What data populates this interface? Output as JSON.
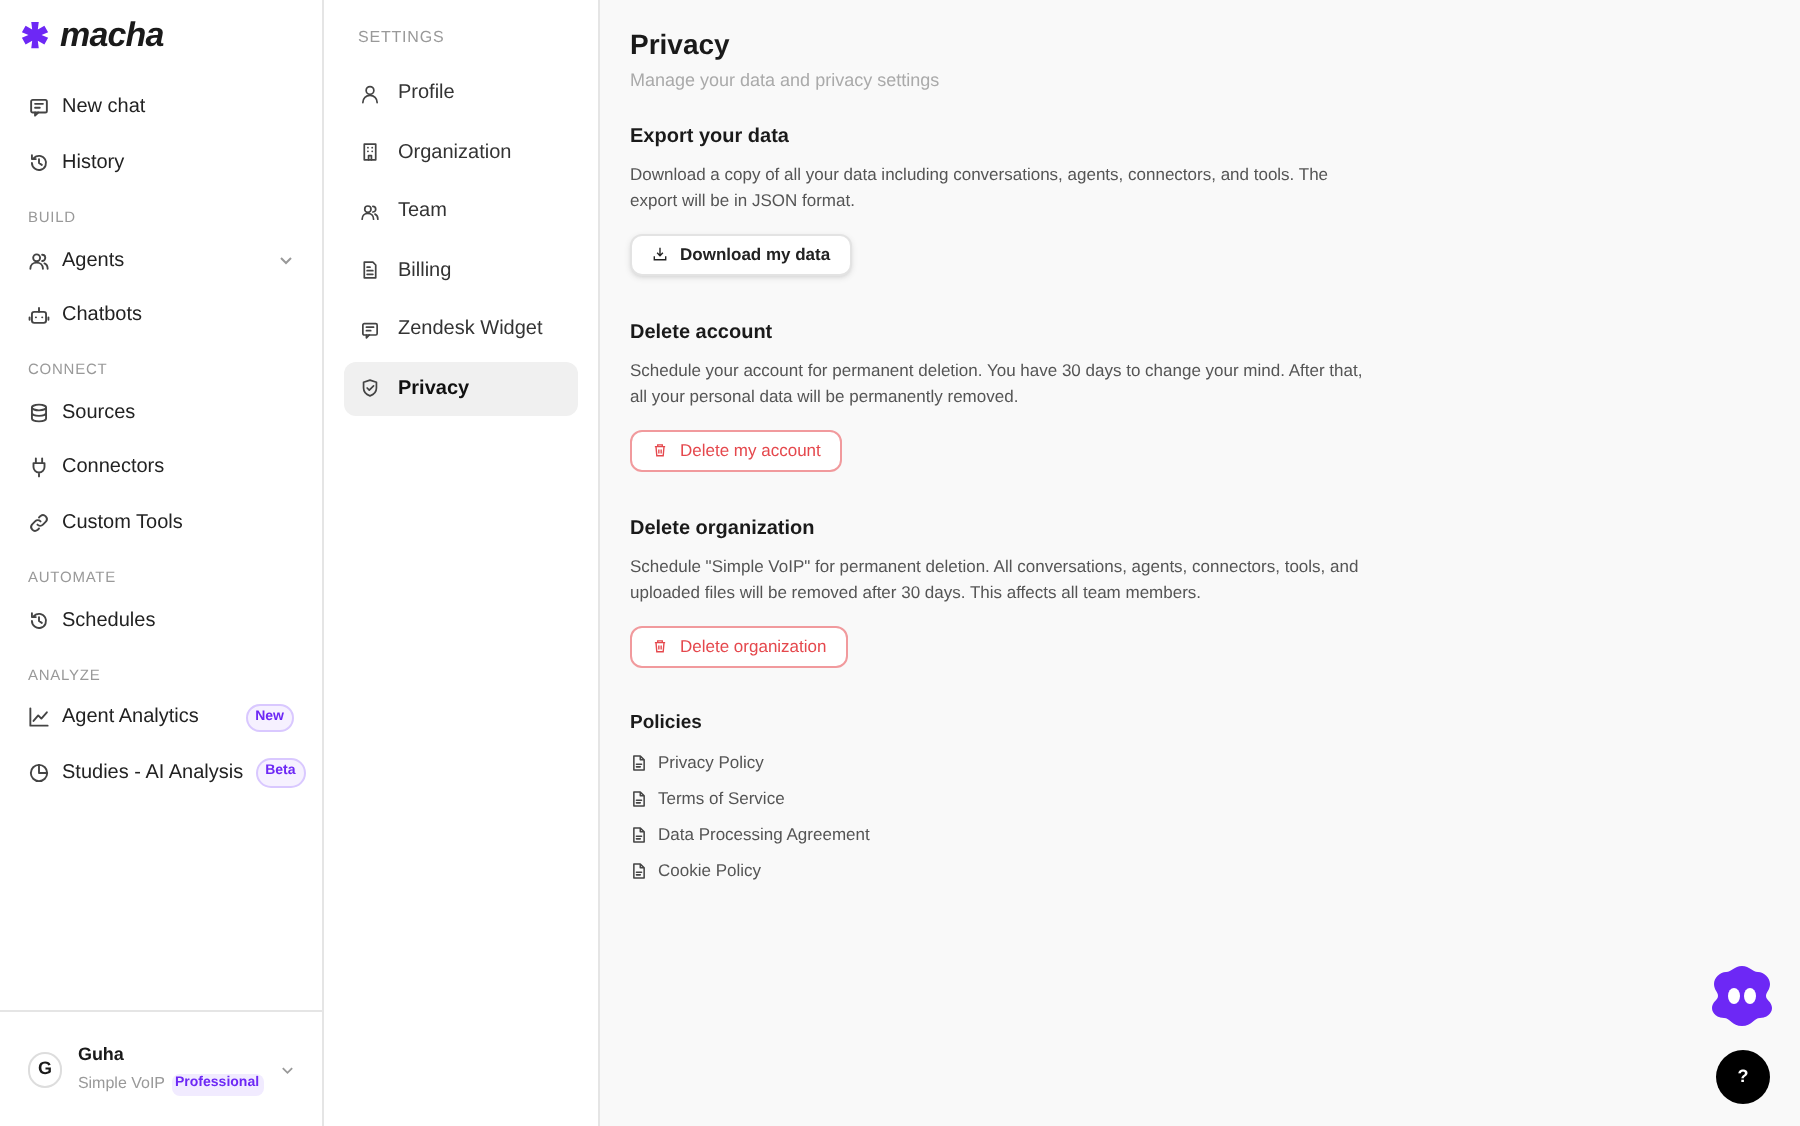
{
  "sidebar": {
    "logo": "macha",
    "top_items": [
      {
        "label": "New chat"
      },
      {
        "label": "History"
      }
    ],
    "sections": [
      {
        "heading": "BUILD",
        "items": [
          {
            "label": "Agents",
            "expanded": false
          },
          {
            "label": "Chatbots"
          }
        ]
      },
      {
        "heading": "CONNECT",
        "items": [
          {
            "label": "Sources"
          },
          {
            "label": "Connectors"
          },
          {
            "label": "Custom Tools"
          }
        ]
      },
      {
        "heading": "AUTOMATE",
        "items": [
          {
            "label": "Schedules"
          }
        ]
      },
      {
        "heading": "ANALYZE",
        "items": [
          {
            "label": "Agent Analytics",
            "badge": "New"
          },
          {
            "label": "Studies - AI Analysis",
            "badge": "Beta"
          }
        ]
      }
    ],
    "user": {
      "initial": "G",
      "name": "Guha",
      "org": "Simple VoIP",
      "plan": "Professional"
    }
  },
  "settings_nav": {
    "heading": "SETTINGS",
    "items": [
      {
        "label": "Profile",
        "selected": false
      },
      {
        "label": "Organization",
        "selected": false
      },
      {
        "label": "Team",
        "selected": false
      },
      {
        "label": "Billing",
        "selected": false
      },
      {
        "label": "Zendesk Widget",
        "selected": false
      },
      {
        "label": "Privacy",
        "selected": true
      }
    ]
  },
  "main": {
    "title": "Privacy",
    "subtitle": "Manage your data and privacy settings",
    "sections": [
      {
        "title": "Export your data",
        "text": "Download a copy of all your data including conversations, agents, connectors, and tools. The export will be in JSON format.",
        "button": {
          "label": "Download my data",
          "kind": "default"
        }
      },
      {
        "title": "Delete account",
        "text": "Schedule your account for permanent deletion. You have 30 days to change your mind. After that, all your personal data will be permanently removed.",
        "button": {
          "label": "Delete my account",
          "kind": "danger"
        }
      },
      {
        "title": "Delete organization",
        "text": "Schedule \"Simple VoIP\" for permanent deletion. All conversations, agents, connectors, tools, and uploaded files will be removed after 30 days. This affects all team members.",
        "button": {
          "label": "Delete organization",
          "kind": "danger"
        }
      }
    ],
    "policies": {
      "title": "Policies",
      "items": [
        "Privacy Policy",
        "Terms of Service",
        "Data Processing Agreement",
        "Cookie Policy"
      ]
    }
  },
  "help_button": "?"
}
